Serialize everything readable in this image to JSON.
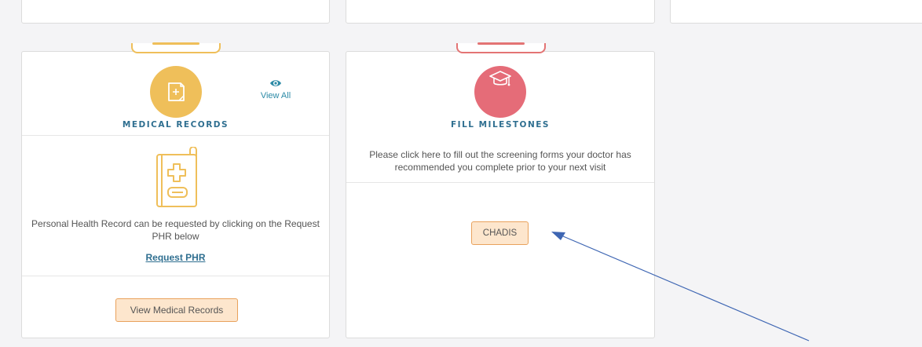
{
  "medical_records": {
    "title": "MEDICAL RECORDS",
    "view_all_label": "View All",
    "description": "Personal Health Record can be requested by clicking on the Request PHR below",
    "request_link": "Request PHR",
    "button_label": "View Medical Records",
    "icon": "document-plus-icon",
    "accent_color": "#efbf5a"
  },
  "fill_milestones": {
    "title": "FILL MILESTONES",
    "description": "Please click here to fill out the screening forms your doctor has recommended you complete prior to your next visit",
    "button_label": "CHADIS",
    "icon": "graduation-cap-icon",
    "accent_color": "#e56c78"
  },
  "annotation": {
    "arrow_color": "#3e66b3"
  }
}
